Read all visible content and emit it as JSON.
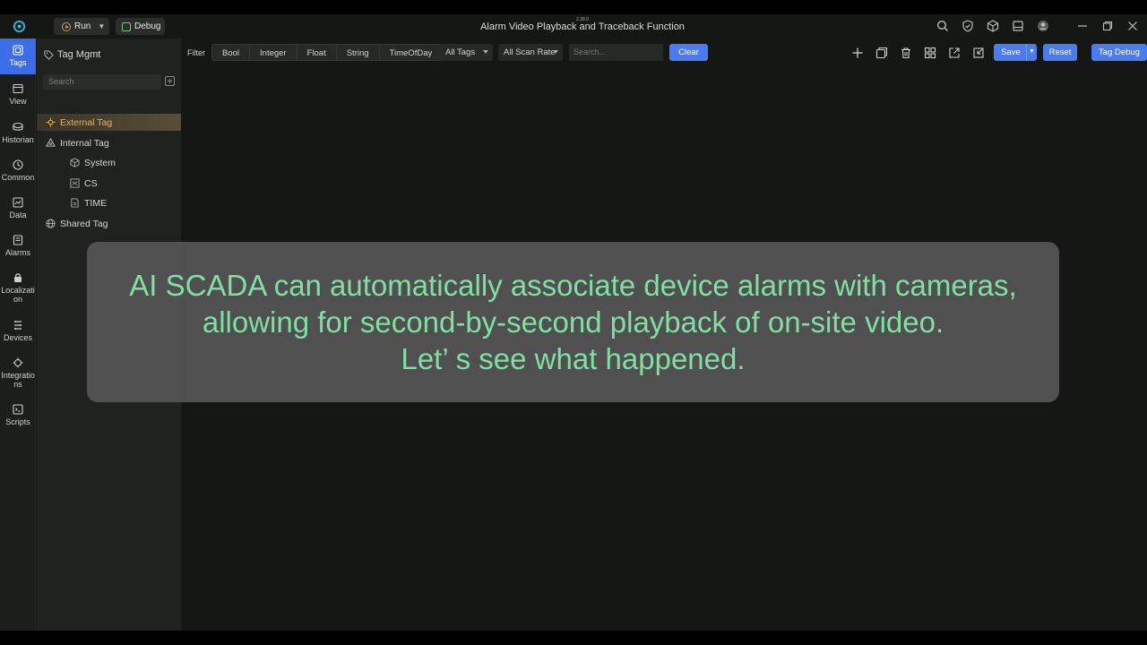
{
  "titlebar": {
    "run_label": "Run",
    "debug_label": "Debug",
    "title": "Alarm Video Playback and Traceback Function",
    "version": "2.38.0"
  },
  "rail": {
    "items": [
      {
        "label": "Tags",
        "icon": "tags-icon"
      },
      {
        "label": "View",
        "icon": "view-icon"
      },
      {
        "label": "Historian",
        "icon": "historian-icon"
      },
      {
        "label": "Common",
        "icon": "common-icon"
      },
      {
        "label": "Data",
        "icon": "data-icon"
      },
      {
        "label": "Alarms",
        "icon": "alarms-icon"
      },
      {
        "label": "Localizati",
        "label2": "on",
        "icon": "localization-icon"
      },
      {
        "label": "Devices",
        "icon": "devices-icon"
      },
      {
        "label": "Integratio",
        "label2": "ns",
        "icon": "integrations-icon"
      },
      {
        "label": "Scripts",
        "icon": "scripts-icon"
      }
    ]
  },
  "tree": {
    "header": "Tag Mgmt",
    "search_placeholder": "Search",
    "items": [
      {
        "label": "External Tag"
      },
      {
        "label": "Internal Tag"
      },
      {
        "label": "System"
      },
      {
        "label": "CS"
      },
      {
        "label": "TIME"
      },
      {
        "label": "Shared Tag"
      }
    ]
  },
  "toolbar": {
    "filter_label": "Filter",
    "types": [
      "Bool",
      "Integer",
      "Float",
      "String",
      "TimeOfDay"
    ],
    "all_tags": "All Tags",
    "scan_rate": "All Scan Rate",
    "search_placeholder": "Search...",
    "clear_label": "Clear",
    "save_label": "Save",
    "reset_label": "Reset",
    "tag_debug_label": "Tag Debug"
  },
  "caption": {
    "line1": "AI SCADA can automatically associate device alarms with cameras,",
    "line2": "allowing for second-by-second playback of on-site video.",
    "line3": "Let’  s see what happened."
  },
  "colors": {
    "accent_blue": "#4a7cf0",
    "selected_orange": "#e9b35f",
    "caption_green": "#7fe0a2"
  }
}
